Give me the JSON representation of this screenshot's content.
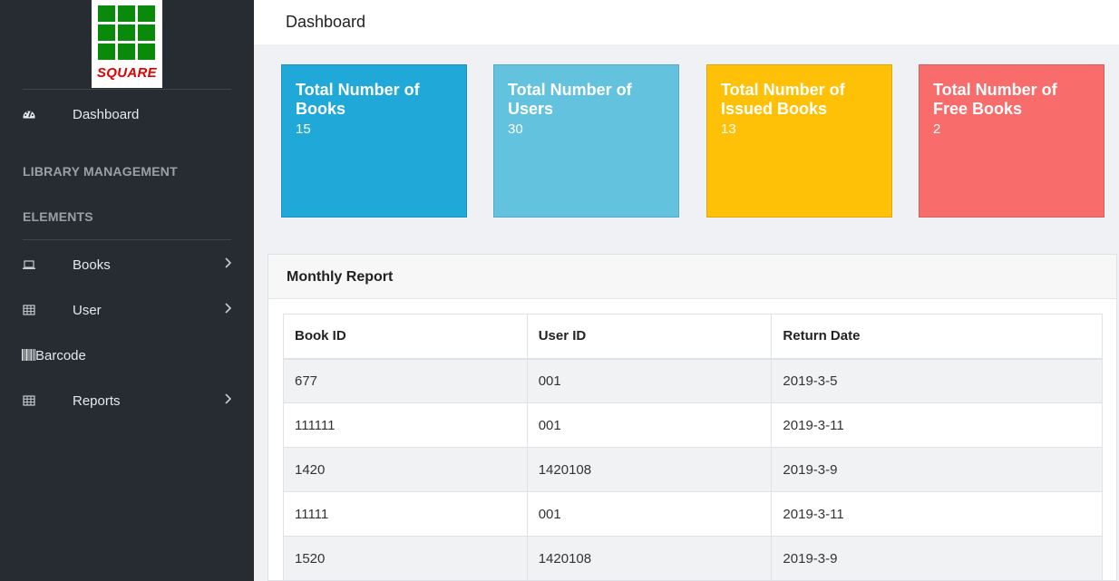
{
  "sidebar": {
    "logo_text": "SQUARE",
    "dashboard_label": "Dashboard",
    "section_library": "LIBRARY MANAGEMENT",
    "section_elements": "ELEMENTS",
    "items": [
      {
        "label": "Books",
        "icon": "laptop-icon",
        "has_chevron": true
      },
      {
        "label": "User",
        "icon": "table-icon",
        "has_chevron": true
      },
      {
        "label": "Barcode",
        "icon": "barcode-icon",
        "has_chevron": false
      },
      {
        "label": "Reports",
        "icon": "table-icon",
        "has_chevron": true
      }
    ]
  },
  "header": {
    "title": "Dashboard"
  },
  "cards": [
    {
      "title": "Total Number of Books",
      "value": "15",
      "color": "#20a8d8"
    },
    {
      "title": "Total Number of Users",
      "value": "30",
      "color": "#63c2de"
    },
    {
      "title": "Total Number of Issued Books",
      "value": "13",
      "color": "#ffc107"
    },
    {
      "title": "Total Number of Free Books",
      "value": "2",
      "color": "#f86c6b"
    }
  ],
  "report": {
    "title": "Monthly Report",
    "columns": [
      "Book ID",
      "User ID",
      "Return Date"
    ],
    "rows": [
      [
        "677",
        "001",
        "2019-3-5"
      ],
      [
        "111111",
        "001",
        "2019-3-11"
      ],
      [
        "1420",
        "1420108",
        "2019-3-9"
      ],
      [
        "11111",
        "001",
        "2019-3-11"
      ],
      [
        "1520",
        "1420108",
        "2019-3-9"
      ]
    ]
  },
  "colors": {
    "sidebar_bg": "#272c33",
    "logo_green": "#0a8a0a",
    "logo_red": "#e00000"
  }
}
